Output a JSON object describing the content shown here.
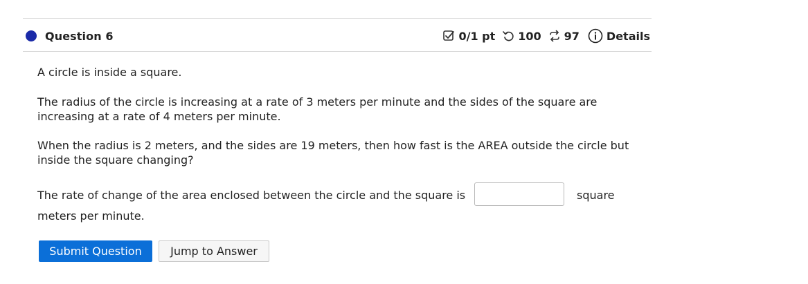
{
  "question": {
    "title": "Question 6",
    "score": "0/1 pt",
    "attempts": "100",
    "retries": "97",
    "details_label": "Details"
  },
  "body": {
    "p1": "A circle is inside a square.",
    "p2": "The radius of the circle is increasing at a rate of 3 meters per minute and the sides of the square are increasing at a rate of 4 meters per minute.",
    "p3": "When the radius is 2 meters, and the sides are 19 meters, then how fast is the AREA outside the circle but inside the square changing?",
    "answer_prompt": "The rate of change of the area enclosed between the circle and the square is",
    "answer_value": "",
    "unit_part1": "square",
    "unit_part2": "meters per minute."
  },
  "buttons": {
    "submit": "Submit Question",
    "jump": "Jump to Answer"
  },
  "colors": {
    "status_dot": "#1a2aa8",
    "primary": "#0b6fd8"
  }
}
